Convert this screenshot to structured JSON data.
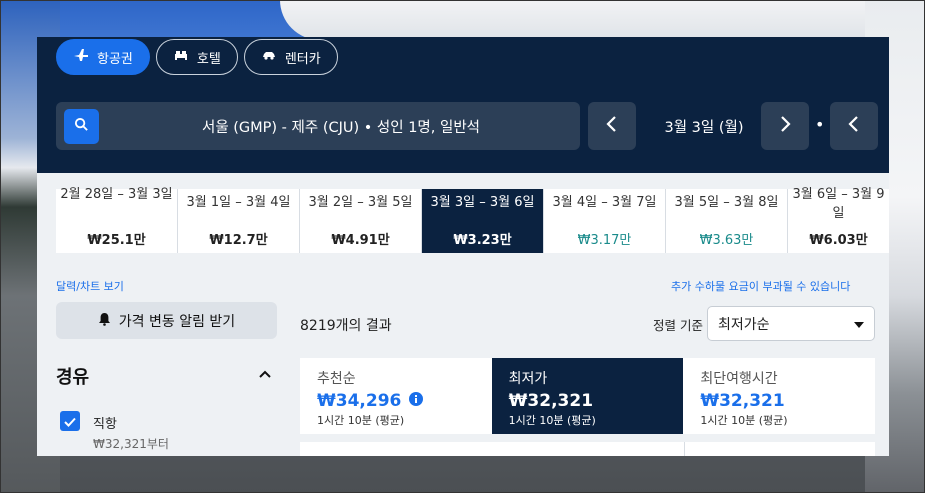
{
  "tabs": [
    {
      "label": "항공권",
      "icon": "plane-icon"
    },
    {
      "label": "호텔",
      "icon": "bed-icon"
    },
    {
      "label": "렌터카",
      "icon": "car-icon"
    }
  ],
  "search": {
    "summary": "서울 (GMP) - 제주 (CJU)  •  성인 1명, 일반석",
    "date": "3월 3일 (월)"
  },
  "date_strip": [
    {
      "range": "2월 28일 – 3월 3일",
      "price": "₩25.1만",
      "style": "normal",
      "cut": true
    },
    {
      "range": "3월 1일 – 3월 4일",
      "price": "₩12.7만",
      "style": "normal"
    },
    {
      "range": "3월 2일 – 3월 5일",
      "price": "₩4.91만",
      "style": "normal"
    },
    {
      "range": "3월 3일 – 3월 6일",
      "price": "₩3.23만",
      "style": "selected"
    },
    {
      "range": "3월 4일 – 3월 7일",
      "price": "₩3.17만",
      "style": "teal"
    },
    {
      "range": "3월 5일 – 3월 8일",
      "price": "₩3.63만",
      "style": "teal"
    },
    {
      "range": "3월 6일 – 3월 9일",
      "price": "₩6.03만",
      "style": "normal",
      "cut": true
    }
  ],
  "links": {
    "calendar": "달력/차트 보기",
    "fees": "추가 수하물 요금이 부과될 수 있습니다"
  },
  "alert_button": "가격 변동 알림 받기",
  "results_count": "8219개의 결과",
  "sort": {
    "label": "정렬 기준",
    "value": "최저가순"
  },
  "filters": {
    "stops_title": "경유",
    "direct": {
      "label": "직항",
      "sub": "₩32,321부터",
      "checked": true
    }
  },
  "sort_tabs": [
    {
      "title": "추천순",
      "price": "₩34,296",
      "sub": "1시간 10분 (평균)",
      "info": true
    },
    {
      "title": "최저가",
      "price": "₩32,321",
      "sub": "1시간 10분 (평균)",
      "selected": true
    },
    {
      "title": "최단여행시간",
      "price": "₩32,321",
      "sub": "1시간 10분 (평균)"
    }
  ],
  "colors": {
    "navy": "#0b2240",
    "accent": "#1a6fea",
    "teal": "#1a8b8b"
  }
}
